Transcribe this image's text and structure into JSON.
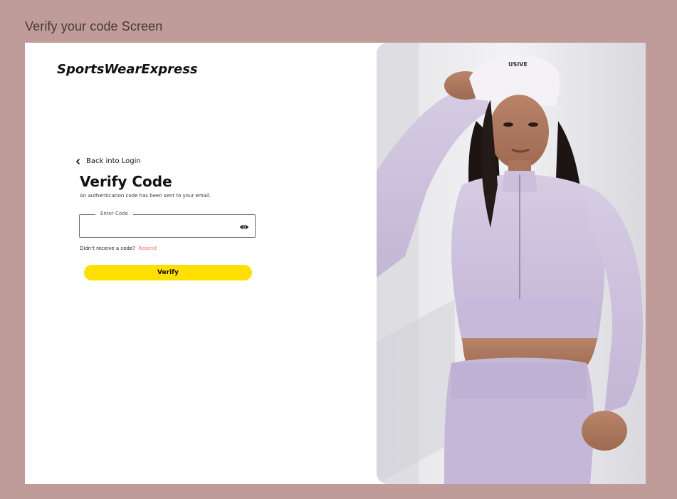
{
  "frame": {
    "title": "Verify your code Screen"
  },
  "brand": {
    "name": "SportsWearExpress"
  },
  "nav": {
    "back_label": "Back into Login"
  },
  "form": {
    "heading": "Verify Code",
    "subtext": "An authentication code has been sent to your email.",
    "code_label": "Enter Code",
    "code_value": "",
    "no_code_text": "Didn't receive a code?",
    "resend_label": "Resend",
    "verify_label": "Verify"
  },
  "hero": {
    "cap_text": "USIVE"
  },
  "colors": {
    "page_bg": "#bf9b9a",
    "accent_button": "#ffdf00",
    "resend_link": "#ff6b73",
    "outfit_lavender": "#c9bcdc"
  },
  "icons": {
    "back": "chevron-left-icon",
    "reveal": "eye-icon"
  }
}
